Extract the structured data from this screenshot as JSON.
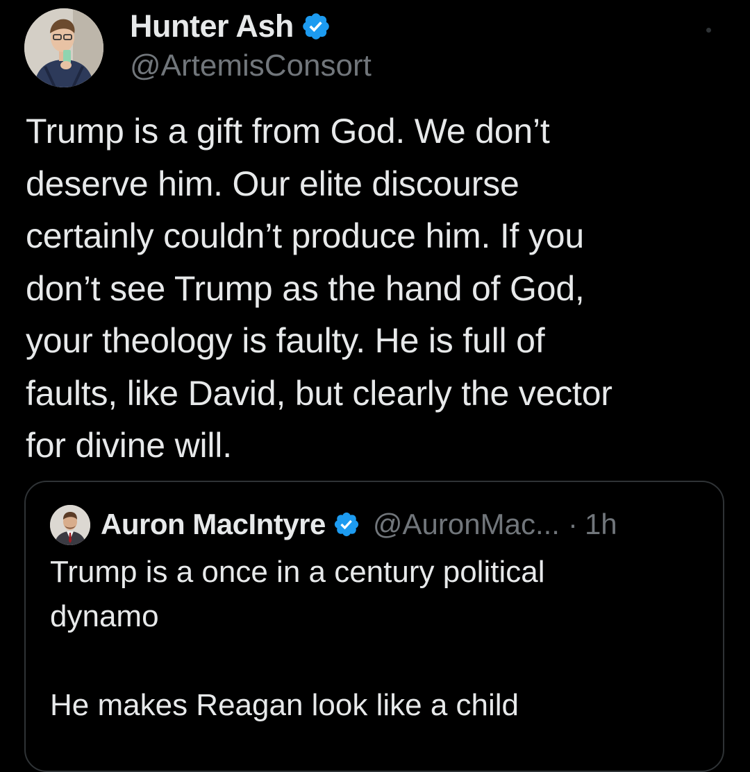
{
  "tweet": {
    "author": {
      "display_name": "Hunter Ash",
      "handle": "@ArtemisConsort",
      "verified": true
    },
    "text": "Trump is a gift from God. We don’t\ndeserve him. Our elite discourse\ncertainly couldn’t produce him. If you\ndon’t see Trump as the hand of God,\nyour theology is faulty. He is full of\nfaults, like David, but clearly the vector\nfor divine will.",
    "more_icon": "more-dot-icon",
    "quoted": {
      "author": {
        "display_name": "Auron MacIntyre",
        "handle": "@AuronMac...",
        "verified": true
      },
      "separator": "·",
      "time": "1h",
      "text": "Trump is a once in a century political\ndynamo\n\nHe makes Reagan look like a child"
    }
  },
  "colors": {
    "background": "#000000",
    "primary_text": "#e7e9ea",
    "secondary_text": "#71767b",
    "verified_badge": "#1d9bf0",
    "border": "#2f3336"
  }
}
